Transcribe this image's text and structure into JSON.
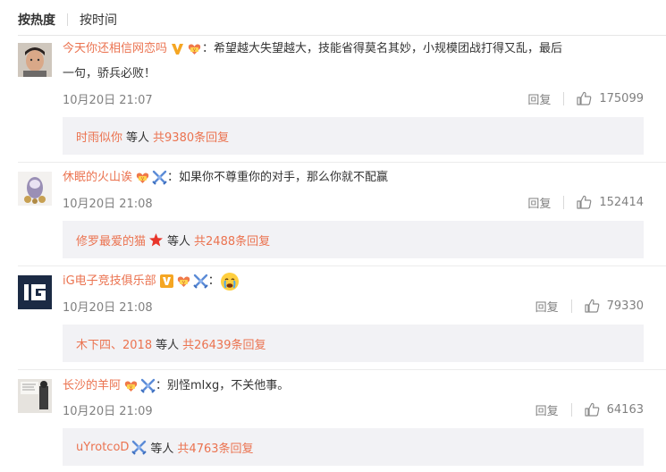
{
  "tabs": [
    {
      "label": "按热度",
      "active": true
    },
    {
      "label": "按时间",
      "active": false
    }
  ],
  "comments": [
    {
      "user": "今天你还相信网恋吗",
      "text": "：希望越大失望越大，技能省得莫名其妙，小规模团战打得又乱，最后",
      "text2": "一句，骄兵必败！",
      "time": "10月20日 21:07",
      "reply_label": "回复",
      "likes": "175099",
      "sub_user": "时雨似你",
      "sub_mid": "等人",
      "sub_count": "共9380条回复"
    },
    {
      "user": "休眠的火山诶",
      "text": "：如果你不尊重你的对手，那么你就不配赢",
      "time": "10月20日 21:08",
      "reply_label": "回复",
      "likes": "152414",
      "sub_user": "修罗最爱的猫",
      "sub_mid": "等人",
      "sub_count": "共2488条回复"
    },
    {
      "user": "iG电子竞技俱乐部",
      "text": "：",
      "time": "10月20日 21:08",
      "reply_label": "回复",
      "likes": "79330",
      "sub_user": "木下四、2018",
      "sub_mid": "等人",
      "sub_count": "共26439条回复"
    },
    {
      "user": "长沙的羊阿",
      "text": "：别怪mlxg，不关他事。",
      "time": "10月20日 21:09",
      "reply_label": "回复",
      "likes": "64163",
      "sub_user": "uYrotcoD",
      "sub_mid": "等人",
      "sub_count": "共4763条回复"
    }
  ],
  "colors": {
    "accent": "#eb7350",
    "meta": "#808080",
    "subbox_bg": "#f2f2f5",
    "vip_gold": "#f5a623",
    "badge_blue": "#5b8bd6",
    "star_red": "#e8352a"
  },
  "icons": {
    "like": "thumbs-up-icon",
    "verified": "gold-v-icon",
    "fan_badge": "super-fan-icon",
    "crossed_swords": "crossed-swords-icon",
    "star": "red-star-icon",
    "emoji": "crying-face-emoji"
  }
}
